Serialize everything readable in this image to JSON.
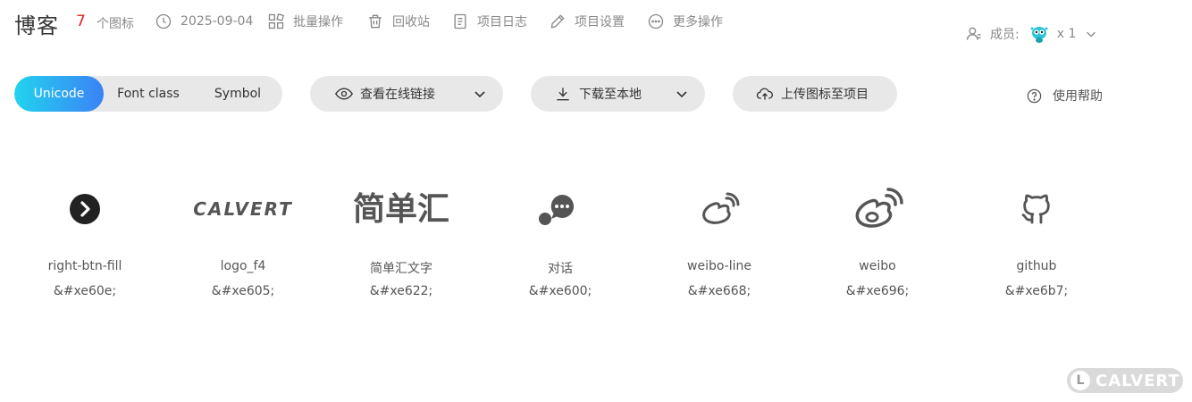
{
  "header": {
    "project_name": "博客",
    "icon_count": "7",
    "icon_count_label": "个图标",
    "date": "2025-09-04",
    "actions": [
      {
        "label": "批量操作",
        "icon": "batch-icon"
      },
      {
        "label": "回收站",
        "icon": "trash-icon"
      },
      {
        "label": "项目日志",
        "icon": "log-icon"
      },
      {
        "label": "项目设置",
        "icon": "edit-icon"
      },
      {
        "label": "更多操作",
        "icon": "more-icon"
      }
    ],
    "members_label": "成员:",
    "members_count": "x 1"
  },
  "toolbar": {
    "tabs": [
      "Unicode",
      "Font class",
      "Symbol"
    ],
    "active_tab": "Unicode",
    "view_link": "查看在线链接",
    "download": "下载至本地",
    "upload": "上传图标至项目",
    "help": "使用帮助"
  },
  "icons": [
    {
      "name": "right-btn-fill",
      "code": "&#xe60e;",
      "glyph": "chevron-circle-icon"
    },
    {
      "name": "logo_f4",
      "code": "&#xe605;",
      "glyph": "calvert-logo-icon",
      "logo_text": "CALVERT"
    },
    {
      "name": "简单汇文字",
      "code": "&#xe622;",
      "glyph": "jiandanhui-text-icon",
      "logo_text": "简单汇"
    },
    {
      "name": "对话",
      "code": "&#xe600;",
      "glyph": "chat-bubble-icon"
    },
    {
      "name": "weibo-line",
      "code": "&#xe668;",
      "glyph": "weibo-line-icon"
    },
    {
      "name": "weibo",
      "code": "&#xe696;",
      "glyph": "weibo-icon"
    },
    {
      "name": "github",
      "code": "&#xe6b7;",
      "glyph": "github-icon"
    }
  ],
  "watermark": {
    "letter": "L",
    "text": "CALVERT"
  },
  "colors": {
    "count_red": "#e02020",
    "tab_gradient_start": "#22d3ee",
    "tab_gradient_end": "#3b82f6",
    "icon_gray": "#444444"
  }
}
